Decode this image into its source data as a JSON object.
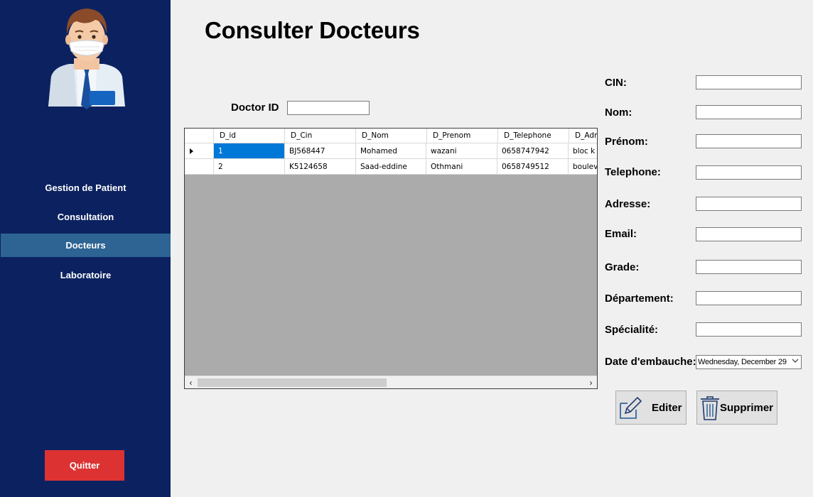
{
  "sidebar": {
    "items": [
      {
        "label": "Gestion de Patient"
      },
      {
        "label": "Consultation"
      },
      {
        "label": "Docteurs"
      },
      {
        "label": "Laboratoire"
      }
    ],
    "active_item": "Docteurs",
    "quit_label": "Quitter",
    "colors": {
      "background": "#0c2260",
      "active": "#2d6493",
      "quit": "#dc3232"
    }
  },
  "main": {
    "title": "Consulter Docteurs",
    "doctor_id_label": "Doctor ID",
    "doctor_id_value": ""
  },
  "grid": {
    "columns": [
      "D_id",
      "D_Cin",
      "D_Nom",
      "D_Prenom",
      "D_Telephone",
      "D_Adre"
    ],
    "rows": [
      [
        "1",
        "BJ568447",
        "Mohamed",
        "wazani",
        "0658747942",
        "bloc k n"
      ],
      [
        "2",
        "K5124658",
        "Saad-eddine",
        "Othmani",
        "0658749512",
        "bouleva"
      ]
    ],
    "selected_row": 0,
    "scroll_left": "‹",
    "scroll_right": "›"
  },
  "form": {
    "fields": [
      {
        "label": "CIN:",
        "value": ""
      },
      {
        "label": "Nom:",
        "value": ""
      },
      {
        "label": "Prénom:",
        "value": ""
      },
      {
        "label": "Telephone:",
        "value": ""
      },
      {
        "label": "Adresse:",
        "value": ""
      },
      {
        "label": "Email:",
        "value": ""
      },
      {
        "label": "Grade:",
        "value": ""
      },
      {
        "label": "Département:",
        "value": ""
      },
      {
        "label": "Spécialité:",
        "value": ""
      }
    ],
    "date_label": "Date d'embauche:",
    "date_value": "Wednesday, December 29"
  },
  "actions": {
    "edit_label": "Editer",
    "delete_label": "Supprimer",
    "edit_icon": "pencil-icon",
    "delete_icon": "trash-icon"
  }
}
